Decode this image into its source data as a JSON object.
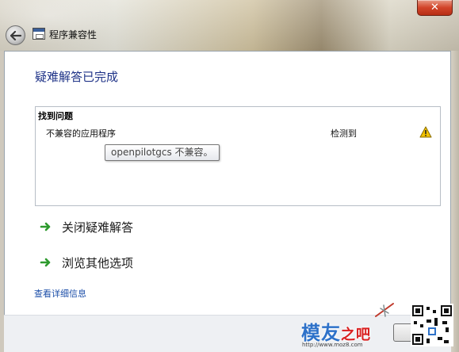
{
  "window": {
    "title": "程序兼容性",
    "close_label": "✕"
  },
  "content": {
    "heading": "疑难解答已完成",
    "problems_header": "找到问题",
    "issue": {
      "name": "不兼容的应用程序",
      "status": "检测到",
      "icon": "warning-icon"
    },
    "tooltip": "openpilotgcs 不兼容。",
    "actions": [
      {
        "label": "关闭疑难解答",
        "icon": "green-arrow-icon"
      },
      {
        "label": "浏览其他选项",
        "icon": "green-arrow-icon"
      }
    ],
    "details_link": "查看详细信息"
  },
  "watermark": {
    "logo": "模友",
    "logo_accent": "之吧",
    "url": "http://www.moz8.com"
  },
  "colors": {
    "heading": "#1e3287",
    "link": "#1b4ea8",
    "arrow": "#2e9a2e",
    "warning": "#f2c200"
  }
}
